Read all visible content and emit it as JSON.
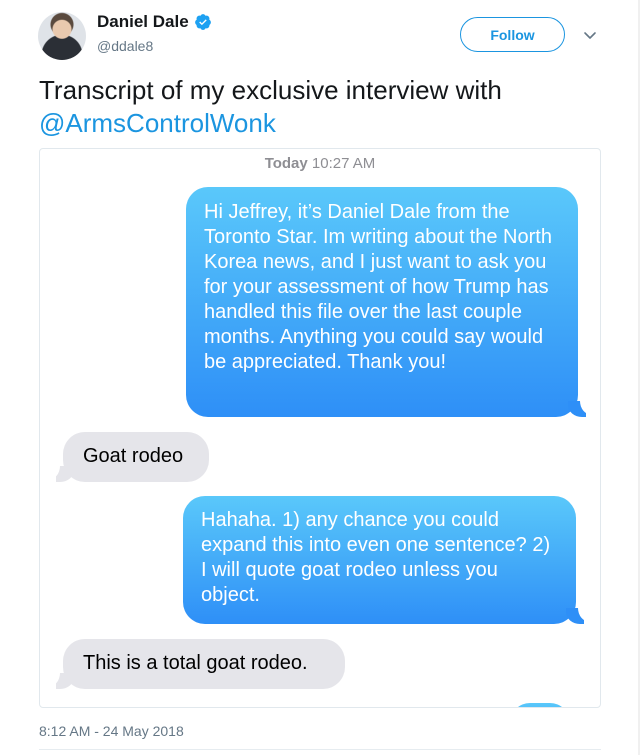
{
  "author": {
    "name": "Daniel Dale",
    "handle": "@ddale8",
    "verified": true,
    "avatar_icon": "avatar"
  },
  "actions": {
    "follow_label": "Follow",
    "menu_icon": "chevron-down-icon"
  },
  "tweet": {
    "text_line": "Transcript of my exclusive interview with",
    "mention": "@ArmsControlWonk",
    "footer_date": "8:12 AM - 24 May 2018"
  },
  "conversation": {
    "timestamp_day": "Today",
    "timestamp_time": "10:27 AM",
    "messages": [
      {
        "from": "me",
        "text": "Hi Jeffrey, it’s Daniel Dale from the Toronto Star. Im writing about the North Korea news, and I just want to ask you for your assessment of how Trump has handled this file over the last couple months. Anything you could say would be appreciated. Thank you!"
      },
      {
        "from": "them",
        "text": "Goat rodeo"
      },
      {
        "from": "me",
        "text": "Hahaha. 1) any chance you could expand this into even one sentence? 2) I will quote goat rodeo unless you object."
      },
      {
        "from": "them",
        "text": "This is a total goat rodeo."
      }
    ]
  },
  "colors": {
    "twitter_blue": "#1b95e0",
    "imessage_blue_top": "#5ac8fa",
    "imessage_blue_bottom": "#2e8ff7",
    "imessage_gray": "#e5e5ea"
  }
}
